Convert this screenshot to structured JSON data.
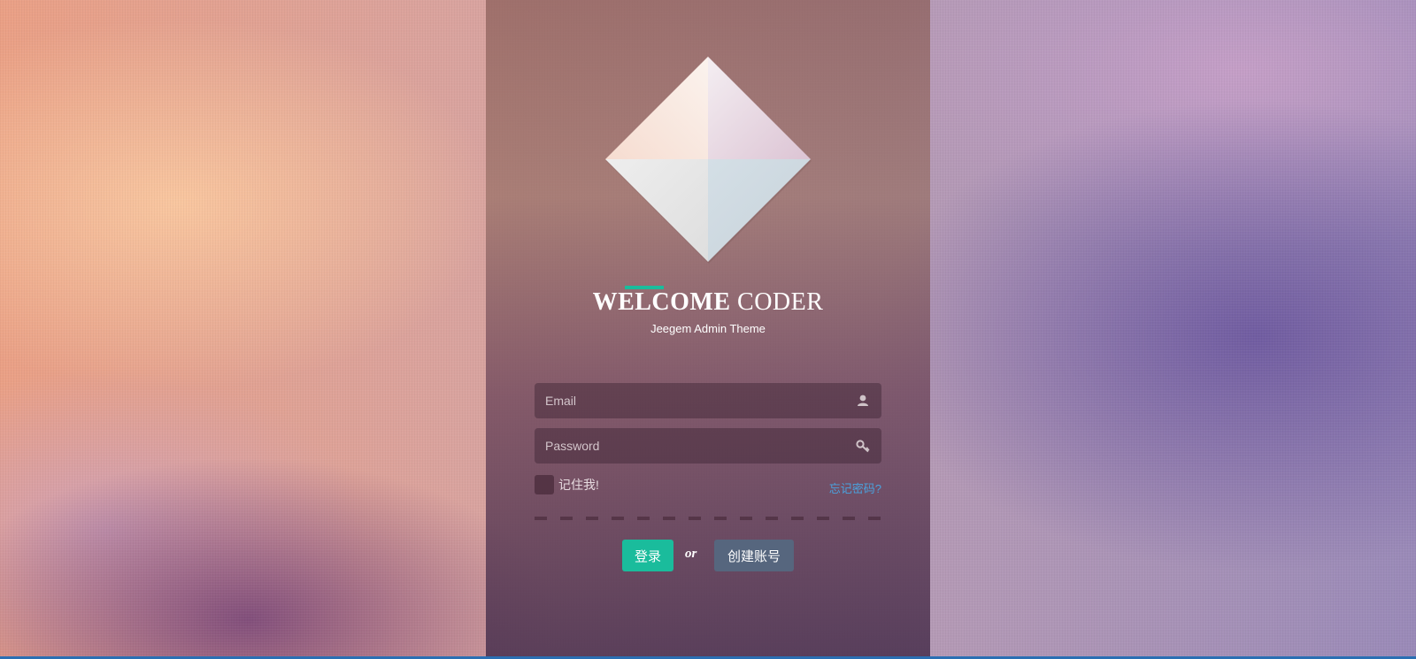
{
  "header": {
    "title_bold": "WELCOME",
    "title_rest": " CODER",
    "subtitle": "Jeegem Admin Theme"
  },
  "form": {
    "email": {
      "placeholder": "Email",
      "value": "",
      "icon": "user-icon"
    },
    "password": {
      "placeholder": "Password",
      "value": "",
      "icon": "key-icon"
    },
    "remember_label": "记住我!",
    "forgot_label": "忘记密码?",
    "login_label": "登录",
    "or_label": "or",
    "create_label": "创建账号"
  },
  "colors": {
    "accent": "#1abc9c",
    "link": "#4aa3df",
    "secondary_button": "#56667e"
  },
  "logo": {
    "icon": "diamond-logo-icon"
  }
}
